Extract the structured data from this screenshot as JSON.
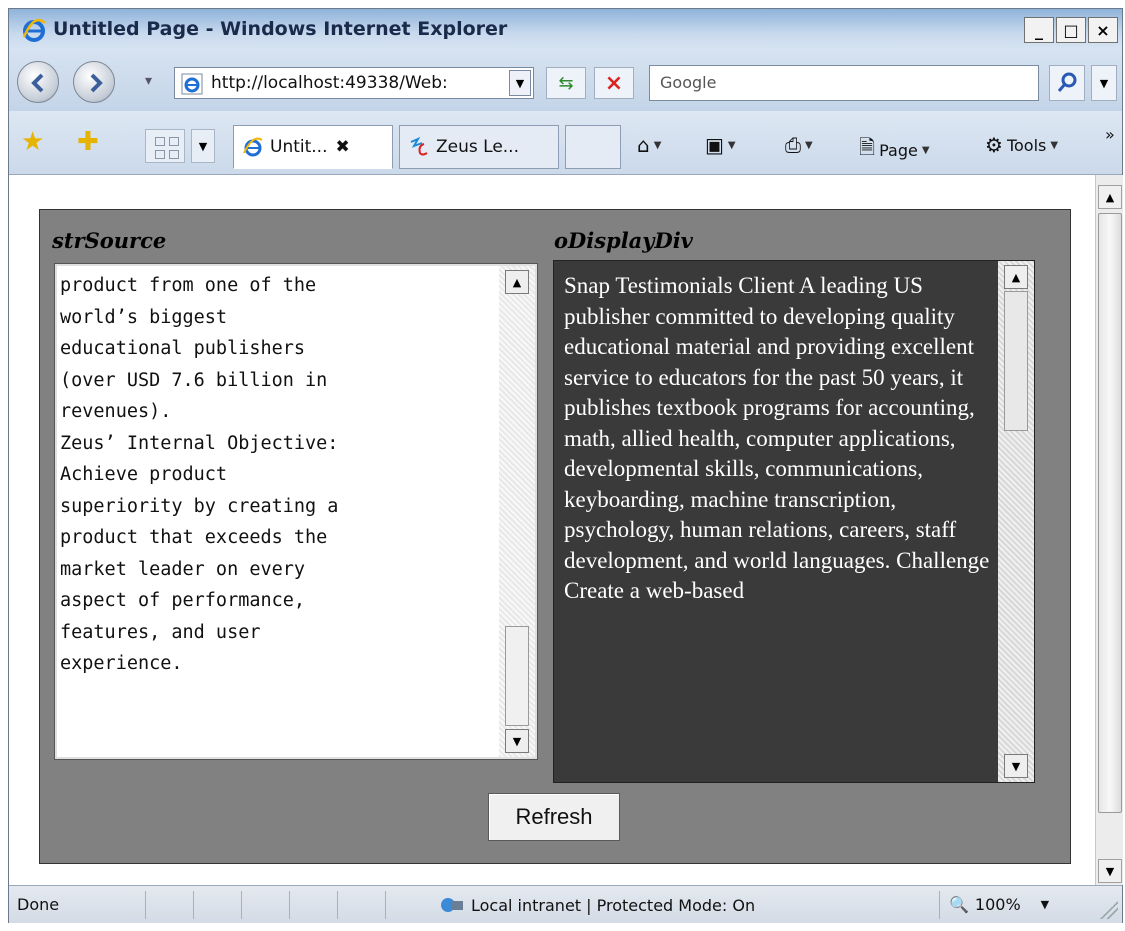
{
  "window": {
    "title": "Untitled Page - Windows Internet Explorer",
    "minimize": "_",
    "maximize": "□",
    "close": "×"
  },
  "address": {
    "url": "http://localhost:49338/Web:",
    "search_placeholder": "Google"
  },
  "tabs": [
    {
      "label": "Untit...",
      "active": true
    },
    {
      "label": "Zeus Le...",
      "active": false
    }
  ],
  "commands": {
    "page": "Page",
    "tools": "Tools",
    "more": "»"
  },
  "page": {
    "source_label": "strSource",
    "display_label": "oDisplayDiv",
    "source_text": "product from one of the\nworld’s biggest\neducational publishers\n(over USD 7.6 billion in\nrevenues).\nZeus’ Internal Objective:\nAchieve product\nsuperiority by creating a\nproduct that exceeds the\nmarket leader on every\naspect of performance,\nfeatures, and user\nexperience.",
    "display_text": "Snap Testimonials Client A leading US publisher committed to developing quality educational material and providing excellent service to educators for the past 50 years, it publishes textbook programs for accounting, math, allied health, computer applications, developmental skills, communications, keyboarding, machine transcription, psychology, human relations, careers, staff development, and world languages. Challenge Create a web-based",
    "refresh_button": "Refresh"
  },
  "status": {
    "text": "Done",
    "zone": "Local intranet | Protected Mode: On",
    "zoom": "100%"
  }
}
